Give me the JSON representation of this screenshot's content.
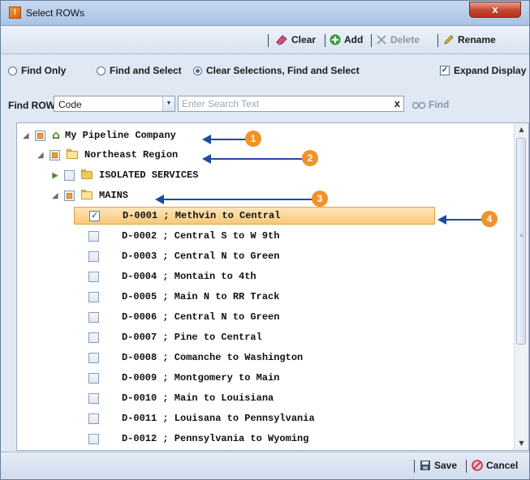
{
  "window": {
    "title": "Select ROWs",
    "close_label": "x"
  },
  "toolbar": {
    "clear_label": "Clear",
    "add_label": "Add",
    "delete_label": "Delete",
    "rename_label": "Rename"
  },
  "radios": [
    {
      "label": "Find Only",
      "selected": false
    },
    {
      "label": "Find and Select",
      "selected": false
    },
    {
      "label": "Clear Selections, Find and Select",
      "selected": true
    }
  ],
  "expand_display": {
    "label": "Expand Display",
    "checked": true
  },
  "find": {
    "label": "Find ROW",
    "field_value": "Code",
    "search_placeholder": "Enter Search Text",
    "clear_label": "x",
    "find_label": "Find"
  },
  "tree": {
    "root": "My Pipeline Company",
    "region": "Northeast Region",
    "isolated": "ISOLATED SERVICES",
    "mains": "MAINS",
    "items": [
      {
        "label": "D-0001 ; Methvin to Central",
        "checked": true
      },
      {
        "label": "D-0002 ; Central S to W 9th",
        "checked": false
      },
      {
        "label": "D-0003 ; Central N  to Green",
        "checked": false
      },
      {
        "label": "D-0004 ; Montain to 4th",
        "checked": false
      },
      {
        "label": "D-0005 ; Main N to RR Track",
        "checked": false
      },
      {
        "label": "D-0006 ; Central N to Green",
        "checked": false
      },
      {
        "label": "D-0007 ; Pine to Central",
        "checked": false
      },
      {
        "label": "D-0008 ; Comanche  to Washington",
        "checked": false
      },
      {
        "label": "D-0009 ; Montgomery to Main",
        "checked": false
      },
      {
        "label": "D-0010 ; Main  to Louisiana",
        "checked": false
      },
      {
        "label": "D-0011 ; Louisana to Pennsylvania",
        "checked": false
      },
      {
        "label": "D-0012 ; Pennsylvania to Wyoming",
        "checked": false
      }
    ]
  },
  "callouts": [
    "1",
    "2",
    "3",
    "4"
  ],
  "footer": {
    "save_label": "Save",
    "cancel_label": "Cancel"
  },
  "colors": {
    "accent": "#f3912a",
    "arrow": "#1f4aa0",
    "selection": "#f8c97a"
  }
}
